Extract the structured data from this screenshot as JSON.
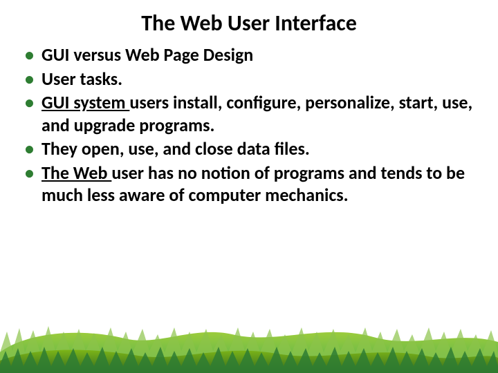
{
  "title": "The Web User Interface",
  "bullets": {
    "b0_strong": "GUI versus Web Page Design",
    "b1": "User tasks.",
    "b2_u": "GUI system ",
    "b2_rest": "users install, configure, personalize, start, use, and upgrade programs.",
    "b3": "They open, use, and close data files.",
    "b4_u": "The Web ",
    "b4_a": "user has ",
    "b4_b": "no notion of programs ",
    "b4_c": "and tends to be much ",
    "b4_d": "less aware ",
    "b4_e": "of computer mechanics."
  },
  "decor": {
    "grass_name": "grass-decoration"
  }
}
